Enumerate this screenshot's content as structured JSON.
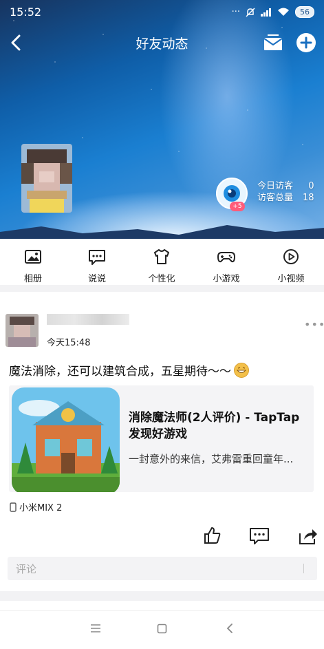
{
  "status_bar": {
    "time": "15:52",
    "indicators": "··· ",
    "battery": "56"
  },
  "header": {
    "title": "好友动态"
  },
  "visitors": {
    "today_label": "今日访客",
    "today_value": "0",
    "total_label": "访客总量",
    "total_value": "18",
    "badge": "+5"
  },
  "icon_bar": {
    "items": [
      {
        "label": "相册",
        "icon": "photo-icon"
      },
      {
        "label": "说说",
        "icon": "chat-bubble-icon"
      },
      {
        "label": "个性化",
        "icon": "tshirt-icon"
      },
      {
        "label": "小游戏",
        "icon": "gamepad-icon"
      },
      {
        "label": "小视频",
        "icon": "play-icon"
      }
    ]
  },
  "post": {
    "time": "今天15:48",
    "text": "魔法消除，还可以建筑合成，五星期待～～",
    "card": {
      "title": "消除魔法师(2人评价) - TapTap发现好游戏",
      "description": "一封意外的来信，艾弗雷重回童年..."
    },
    "device": "小米MIX 2",
    "comment_placeholder": "评论"
  },
  "colors": {
    "sky": "#1a7fd1",
    "badge": "#ff5c7a"
  }
}
